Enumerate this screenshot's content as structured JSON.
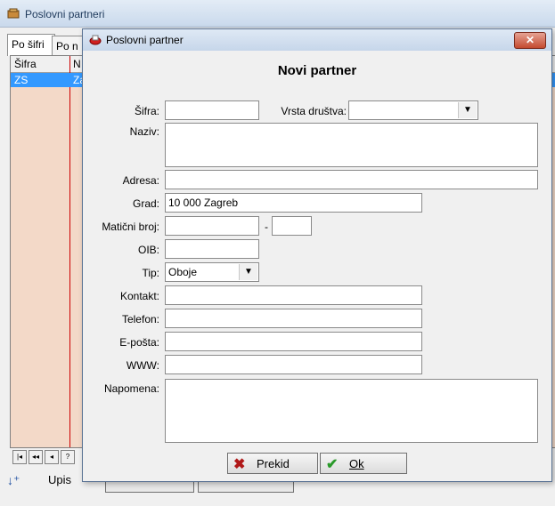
{
  "background_window": {
    "title": "Poslovni partneri",
    "tabs": [
      "Po šifri",
      "Po n"
    ],
    "grid": {
      "headers": [
        "Šifra",
        "N"
      ],
      "selected_row": [
        "ZS",
        "Za"
      ]
    },
    "nav_buttons": [
      "|◂",
      "◂◂",
      "◂",
      "?"
    ],
    "upis_label": "Upis"
  },
  "dialog": {
    "title": "Poslovni partner",
    "heading": "Novi partner",
    "close_label": "✕",
    "labels": {
      "sifra": "Šifra:",
      "vrsta_drustva": "Vrsta društva:",
      "naziv": "Naziv:",
      "adresa": "Adresa:",
      "grad": "Grad:",
      "maticni_broj": "Matični broj:",
      "maticni_sep": "-",
      "oib": "OIB:",
      "tip": "Tip:",
      "kontakt": "Kontakt:",
      "telefon": "Telefon:",
      "eposta": "E-pošta:",
      "www": "WWW:",
      "napomena": "Napomena:"
    },
    "values": {
      "sifra": "",
      "vrsta_drustva": "",
      "naziv": "",
      "adresa": "",
      "grad": "10 000  Zagreb",
      "maticni_broj": "",
      "maticni_suffix": "",
      "oib": "",
      "tip": "Oboje",
      "kontakt": "",
      "telefon": "",
      "eposta": "",
      "www": "",
      "napomena": ""
    },
    "buttons": {
      "prekid": "Prekid",
      "ok": "Ok"
    }
  },
  "colors": {
    "grid_background": "#f3d9c8",
    "selection": "#3399ff",
    "close_button": "#c44a2f"
  }
}
